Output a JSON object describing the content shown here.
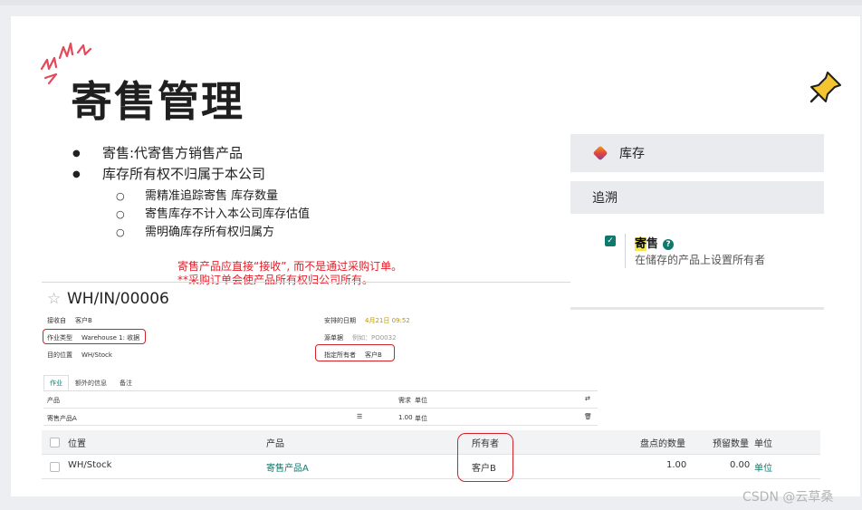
{
  "slide": {
    "title": "寄售管理",
    "bullets": [
      "寄售:代寄售方销售产品",
      "库存所有权不归属于本公司"
    ],
    "sub_bullets": [
      "需精准追踪寄售 库存数量",
      "寄售库存不计入本公司库存估值",
      "需明确库存所有权归属方"
    ],
    "note_line1": "寄售产品应直接“接收”, 而不是通过采购订单。",
    "note_line2": "**采购订单会使产品所有权归公司所有。"
  },
  "settings": {
    "app_label": "库存",
    "section_label": "追溯",
    "consign_title_hl": "寄",
    "consign_title_rest": "售",
    "consign_help_icon": "?",
    "consign_desc": "在储存的产品上设置所有者",
    "checked": true
  },
  "form": {
    "reference": "WH/IN/00006",
    "receive_from_label": "接收自",
    "receive_from_value": "客户B",
    "op_type_label": "作业类型",
    "op_type_value": "Warehouse 1: 收据",
    "dest_label": "目的位置",
    "dest_value": "WH/Stock",
    "scheduled_label": "安排的日期",
    "scheduled_value": "4月21日 09:52",
    "source_doc_label": "源单据",
    "source_doc_value": "例如：PO0032",
    "owner_label": "指定所有者",
    "owner_value": "客户B",
    "tabs": [
      "作业",
      "额外的信息",
      "备注"
    ],
    "moves_header": {
      "product": "产品",
      "demand": "需求",
      "unit": "单位"
    },
    "move_row": {
      "product": "寄售产品A",
      "qty": "1.00",
      "unit": "单位"
    }
  },
  "detail_table": {
    "headers": {
      "location": "位置",
      "product": "产品",
      "owner": "所有者",
      "counted": "盘点的数量",
      "reserved": "预留数量",
      "unit": "单位"
    },
    "row": {
      "location": "WH/Stock",
      "product": "寄售产品A",
      "owner": "客户B",
      "counted": "1.00",
      "reserved": "0.00",
      "unit": "单位"
    }
  },
  "watermark": "CSDN @云草桑",
  "colors": {
    "accent": "#0f7a6c",
    "note_red": "#e0202a",
    "highlight": "#f7e84a"
  }
}
